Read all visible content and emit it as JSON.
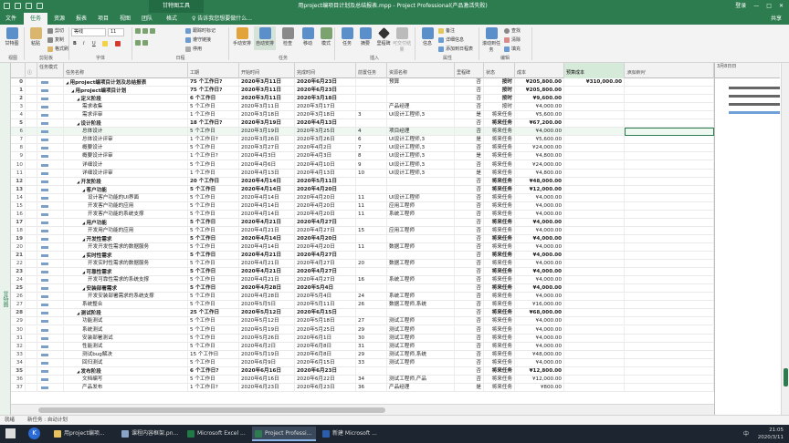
{
  "window": {
    "title": "用project编项目计划及总结报表.mpp - Project Professional(产品激活失败)",
    "context_tab": "甘特图工具",
    "signin": "登录",
    "minimize": "—",
    "maximize": "□",
    "close": "✕"
  },
  "tabs": [
    "文件",
    "任务",
    "资源",
    "报表",
    "项目",
    "视图",
    "团队",
    "格式"
  ],
  "tell_me": "♀ 告诉我您想要做什么...",
  "share": "共享",
  "ribbon": {
    "gantt_view": "甘特图",
    "paste": "粘贴",
    "cut": "剪切",
    "copy": "复制",
    "format_painter": "格式刷",
    "font_name": "等线",
    "font_size": "11",
    "bold": "B",
    "italic": "I",
    "underline": "U",
    "mark_on_track": "跟踪时标记",
    "respect_links": "遵守链接",
    "deactivate": "停用",
    "manual_schedule": "手动安排",
    "auto_schedule": "自动安排",
    "inspect": "检查",
    "move": "移动",
    "mode": "模式",
    "task": "任务",
    "summary": "摘要",
    "milestone": "里程碑",
    "deliverable": "可交付结果",
    "information": "信息",
    "notes": "备注",
    "details": "详细信息",
    "add_to_timeline": "添加到日程表",
    "scroll_to_task": "滚动到任务",
    "find": "查找",
    "clear": "清除",
    "fill": "填充",
    "groups": [
      "视图",
      "剪贴板",
      "字体",
      "日程",
      "任务",
      "插入",
      "属性",
      "编辑"
    ]
  },
  "side_label": "甘特图",
  "columns": [
    "任务模式",
    "任务名称",
    "工期",
    "开始时间",
    "完成时间",
    "前置任务",
    "资源名称",
    "里程碑",
    "状态",
    "成本",
    "预算成本",
    "添加新列"
  ],
  "rows": [
    {
      "id": "0",
      "name": "用project编项目计划及总结报表",
      "indent": 0,
      "bold": true,
      "dur": "75 个工作日?",
      "start": "2020年3月11日",
      "finish": "2020年6月23日",
      "pred": "",
      "res": "预算",
      "ms": "否",
      "status": "按时",
      "cost": "¥205,800.00",
      "budget": "¥310,000.00"
    },
    {
      "id": "1",
      "name": "用project编项目计划",
      "indent": 1,
      "bold": true,
      "dur": "75 个工作日?",
      "start": "2020年3月11日",
      "finish": "2020年6月23日",
      "pred": "",
      "res": "",
      "ms": "否",
      "status": "按时",
      "cost": "¥205,800.00",
      "budget": ""
    },
    {
      "id": "2",
      "name": "定义阶段",
      "indent": 2,
      "bold": true,
      "dur": "6 个工作日",
      "start": "2020年3月11日",
      "finish": "2020年3月18日",
      "pred": "",
      "res": "",
      "ms": "否",
      "status": "按时",
      "cost": "¥9,600.00",
      "budget": ""
    },
    {
      "id": "3",
      "name": "需求收集",
      "indent": 3,
      "bold": false,
      "dur": "5 个工作日",
      "start": "2020年3月11日",
      "finish": "2020年3月17日",
      "pred": "",
      "res": "产品经理",
      "ms": "否",
      "status": "按时",
      "cost": "¥4,000.00",
      "budget": ""
    },
    {
      "id": "4",
      "name": "需求评审",
      "indent": 3,
      "bold": false,
      "dur": "1 个工作日",
      "start": "2020年3月18日",
      "finish": "2020年3月18日",
      "pred": "3",
      "res": "UI设计工程师,3",
      "ms": "是",
      "status": "将来任务",
      "cost": "¥5,600.00",
      "budget": ""
    },
    {
      "id": "5",
      "name": "设计阶段",
      "indent": 2,
      "bold": true,
      "dur": "18 个工作日?",
      "start": "2020年3月19日",
      "finish": "2020年4月13日",
      "pred": "",
      "res": "",
      "ms": "否",
      "status": "将来任务",
      "cost": "¥67,200.00",
      "budget": ""
    },
    {
      "id": "6",
      "name": "总体设计",
      "indent": 3,
      "bold": false,
      "dur": "5 个工作日",
      "start": "2020年3月19日",
      "finish": "2020年3月25日",
      "pred": "4",
      "res": "项目经理",
      "ms": "否",
      "status": "将来任务",
      "cost": "¥4,000.00",
      "budget": ""
    },
    {
      "id": "7",
      "name": "总体设计评审",
      "indent": 3,
      "bold": false,
      "dur": "1 个工作日?",
      "start": "2020年3月26日",
      "finish": "2020年3月26日",
      "pred": "6",
      "res": "UI设计工程师,3",
      "ms": "是",
      "status": "将来任务",
      "cost": "¥5,600.00",
      "budget": ""
    },
    {
      "id": "8",
      "name": "概要设计",
      "indent": 3,
      "bold": false,
      "dur": "5 个工作日",
      "start": "2020年3月27日",
      "finish": "2020年4月2日",
      "pred": "7",
      "res": "UI设计工程师,3",
      "ms": "否",
      "status": "将来任务",
      "cost": "¥24,000.00",
      "budget": ""
    },
    {
      "id": "9",
      "name": "概要设计评审",
      "indent": 3,
      "bold": false,
      "dur": "1 个工作日?",
      "start": "2020年4月3日",
      "finish": "2020年4月3日",
      "pred": "8",
      "res": "UI设计工程师,3",
      "ms": "是",
      "status": "将来任务",
      "cost": "¥4,800.00",
      "budget": ""
    },
    {
      "id": "10",
      "name": "详细设计",
      "indent": 3,
      "bold": false,
      "dur": "5 个工作日",
      "start": "2020年4月6日",
      "finish": "2020年4月10日",
      "pred": "9",
      "res": "UI设计工程师,3",
      "ms": "否",
      "status": "将来任务",
      "cost": "¥24,000.00",
      "budget": ""
    },
    {
      "id": "11",
      "name": "详细设计评审",
      "indent": 3,
      "bold": false,
      "dur": "1 个工作日",
      "start": "2020年4月13日",
      "finish": "2020年4月13日",
      "pred": "10",
      "res": "UI设计工程师,3",
      "ms": "是",
      "status": "将来任务",
      "cost": "¥4,800.00",
      "budget": ""
    },
    {
      "id": "12",
      "name": "开发阶段",
      "indent": 2,
      "bold": true,
      "dur": "20 个工作日",
      "start": "2020年4月14日",
      "finish": "2020年5月11日",
      "pred": "",
      "res": "",
      "ms": "否",
      "status": "将来任务",
      "cost": "¥48,000.00",
      "budget": ""
    },
    {
      "id": "13",
      "name": "客户功能",
      "indent": 3,
      "bold": true,
      "dur": "5 个工作日",
      "start": "2020年4月14日",
      "finish": "2020年4月20日",
      "pred": "",
      "res": "",
      "ms": "否",
      "status": "将来任务",
      "cost": "¥12,000.00",
      "budget": ""
    },
    {
      "id": "14",
      "name": "设计客户功能的UI界面",
      "indent": 4,
      "bold": false,
      "dur": "5 个工作日",
      "start": "2020年4月14日",
      "finish": "2020年4月20日",
      "pred": "11",
      "res": "UI设计工程师",
      "ms": "否",
      "status": "将来任务",
      "cost": "¥4,000.00",
      "budget": ""
    },
    {
      "id": "15",
      "name": "开发客户功能的应用",
      "indent": 4,
      "bold": false,
      "dur": "5 个工作日",
      "start": "2020年4月14日",
      "finish": "2020年4月20日",
      "pred": "11",
      "res": "应用工程师",
      "ms": "否",
      "status": "将来任务",
      "cost": "¥4,000.00",
      "budget": ""
    },
    {
      "id": "16",
      "name": "开发客户功能的系统支撑",
      "indent": 4,
      "bold": false,
      "dur": "5 个工作日",
      "start": "2020年4月14日",
      "finish": "2020年4月20日",
      "pred": "11",
      "res": "系统工程师",
      "ms": "否",
      "status": "将来任务",
      "cost": "¥4,000.00",
      "budget": ""
    },
    {
      "id": "17",
      "name": "用户功能",
      "indent": 3,
      "bold": true,
      "dur": "5 个工作日",
      "start": "2020年4月21日",
      "finish": "2020年4月27日",
      "pred": "",
      "res": "",
      "ms": "否",
      "status": "将来任务",
      "cost": "¥4,000.00",
      "budget": ""
    },
    {
      "id": "18",
      "name": "开发用户功能的应用",
      "indent": 4,
      "bold": false,
      "dur": "5 个工作日",
      "start": "2020年4月21日",
      "finish": "2020年4月27日",
      "pred": "15",
      "res": "应用工程师",
      "ms": "否",
      "status": "将来任务",
      "cost": "¥4,000.00",
      "budget": ""
    },
    {
      "id": "19",
      "name": "开发性需求",
      "indent": 3,
      "bold": true,
      "dur": "5 个工作日",
      "start": "2020年4月14日",
      "finish": "2020年4月20日",
      "pred": "",
      "res": "",
      "ms": "否",
      "status": "将来任务",
      "cost": "¥4,000.00",
      "budget": ""
    },
    {
      "id": "20",
      "name": "开发开发性需求的数据服务",
      "indent": 4,
      "bold": false,
      "dur": "5 个工作日",
      "start": "2020年4月14日",
      "finish": "2020年4月20日",
      "pred": "11",
      "res": "数据工程师",
      "ms": "否",
      "status": "将来任务",
      "cost": "¥4,000.00",
      "budget": ""
    },
    {
      "id": "21",
      "name": "实时性需求",
      "indent": 3,
      "bold": true,
      "dur": "5 个工作日",
      "start": "2020年4月21日",
      "finish": "2020年4月27日",
      "pred": "",
      "res": "",
      "ms": "否",
      "status": "将来任务",
      "cost": "¥4,000.00",
      "budget": ""
    },
    {
      "id": "22",
      "name": "开发实时性需求的数据服务",
      "indent": 4,
      "bold": false,
      "dur": "5 个工作日",
      "start": "2020年4月21日",
      "finish": "2020年4月27日",
      "pred": "20",
      "res": "数据工程师",
      "ms": "否",
      "status": "将来任务",
      "cost": "¥4,000.00",
      "budget": ""
    },
    {
      "id": "23",
      "name": "可靠性需求",
      "indent": 3,
      "bold": true,
      "dur": "5 个工作日",
      "start": "2020年4月21日",
      "finish": "2020年4月27日",
      "pred": "",
      "res": "",
      "ms": "否",
      "status": "将来任务",
      "cost": "¥4,000.00",
      "budget": ""
    },
    {
      "id": "24",
      "name": "开发可靠性需求的系统支撑",
      "indent": 4,
      "bold": false,
      "dur": "5 个工作日",
      "start": "2020年4月21日",
      "finish": "2020年4月27日",
      "pred": "16",
      "res": "系统工程师",
      "ms": "否",
      "status": "将来任务",
      "cost": "¥4,000.00",
      "budget": ""
    },
    {
      "id": "25",
      "name": "安装部署需求",
      "indent": 3,
      "bold": true,
      "dur": "5 个工作日",
      "start": "2020年4月28日",
      "finish": "2020年5月4日",
      "pred": "",
      "res": "",
      "ms": "否",
      "status": "将来任务",
      "cost": "¥4,000.00",
      "budget": ""
    },
    {
      "id": "26",
      "name": "开发安装部署需求的系统支撑",
      "indent": 4,
      "bold": false,
      "dur": "5 个工作日",
      "start": "2020年4月28日",
      "finish": "2020年5月4日",
      "pred": "24",
      "res": "系统工程师",
      "ms": "否",
      "status": "将来任务",
      "cost": "¥4,000.00",
      "budget": ""
    },
    {
      "id": "27",
      "name": "系统整合",
      "indent": 3,
      "bold": false,
      "dur": "5 个工作日",
      "start": "2020年5月5日",
      "finish": "2020年5月11日",
      "pred": "26",
      "res": "数据工程师,系统",
      "ms": "否",
      "status": "将来任务",
      "cost": "¥16,000.00",
      "budget": ""
    },
    {
      "id": "28",
      "name": "测试阶段",
      "indent": 2,
      "bold": true,
      "dur": "25 个工作日",
      "start": "2020年5月12日",
      "finish": "2020年6月15日",
      "pred": "",
      "res": "",
      "ms": "否",
      "status": "将来任务",
      "cost": "¥68,000.00",
      "budget": ""
    },
    {
      "id": "29",
      "name": "功能测试",
      "indent": 3,
      "bold": false,
      "dur": "5 个工作日",
      "start": "2020年5月12日",
      "finish": "2020年5月18日",
      "pred": "27",
      "res": "测试工程师",
      "ms": "否",
      "status": "将来任务",
      "cost": "¥4,000.00",
      "budget": ""
    },
    {
      "id": "30",
      "name": "系统测试",
      "indent": 3,
      "bold": false,
      "dur": "5 个工作日",
      "start": "2020年5月19日",
      "finish": "2020年5月25日",
      "pred": "29",
      "res": "测试工程师",
      "ms": "否",
      "status": "将来任务",
      "cost": "¥4,000.00",
      "budget": ""
    },
    {
      "id": "31",
      "name": "安装部署测试",
      "indent": 3,
      "bold": false,
      "dur": "5 个工作日",
      "start": "2020年5月26日",
      "finish": "2020年6月1日",
      "pred": "30",
      "res": "测试工程师",
      "ms": "否",
      "status": "将来任务",
      "cost": "¥4,000.00",
      "budget": ""
    },
    {
      "id": "32",
      "name": "性能测试",
      "indent": 3,
      "bold": false,
      "dur": "5 个工作日",
      "start": "2020年6月2日",
      "finish": "2020年6月8日",
      "pred": "31",
      "res": "测试工程师",
      "ms": "否",
      "status": "将来任务",
      "cost": "¥4,000.00",
      "budget": ""
    },
    {
      "id": "33",
      "name": "测试bug解决",
      "indent": 3,
      "bold": false,
      "dur": "15 个工作日",
      "start": "2020年5月19日",
      "finish": "2020年6月8日",
      "pred": "29",
      "res": "测试工程师,系统",
      "ms": "否",
      "status": "将来任务",
      "cost": "¥48,000.00",
      "budget": ""
    },
    {
      "id": "34",
      "name": "回归测试",
      "indent": 3,
      "bold": false,
      "dur": "5 个工作日",
      "start": "2020年6月9日",
      "finish": "2020年6月15日",
      "pred": "33",
      "res": "测试工程师",
      "ms": "否",
      "status": "将来任务",
      "cost": "¥4,000.00",
      "budget": ""
    },
    {
      "id": "35",
      "name": "发布阶段",
      "indent": 2,
      "bold": true,
      "dur": "6 个工作日?",
      "start": "2020年6月16日",
      "finish": "2020年6月23日",
      "pred": "",
      "res": "",
      "ms": "否",
      "status": "将来任务",
      "cost": "¥12,800.00",
      "budget": ""
    },
    {
      "id": "36",
      "name": "文档编写",
      "indent": 3,
      "bold": false,
      "dur": "5 个工作日",
      "start": "2020年6月16日",
      "finish": "2020年6月22日",
      "pred": "34",
      "res": "测试工程师,产品",
      "ms": "否",
      "status": "将来任务",
      "cost": "¥12,000.00",
      "budget": ""
    },
    {
      "id": "37",
      "name": "产品发布",
      "indent": 3,
      "bold": false,
      "dur": "1 个工作日?",
      "start": "2020年6月23日",
      "finish": "2020年6月23日",
      "pred": "36",
      "res": "产品经理",
      "ms": "是",
      "status": "将来任务",
      "cost": "¥800.00",
      "budget": ""
    }
  ],
  "gantt_header": "3月8日日",
  "status": {
    "ready": "就绪",
    "new_tasks": "新任务 : 自动计划"
  },
  "taskbar": {
    "items": [
      "用project编项...",
      "课程内容框架.pn...",
      "Microsoft Excel ...",
      "Project Professi...",
      "新建 Microsoft ..."
    ],
    "lang": "中",
    "time": "21:05",
    "date": "2020/3/11"
  },
  "colors": {
    "accent": "#2c7c4f",
    "tab_bg": "#2c7c4f",
    "taskbar": "#1c2530"
  }
}
